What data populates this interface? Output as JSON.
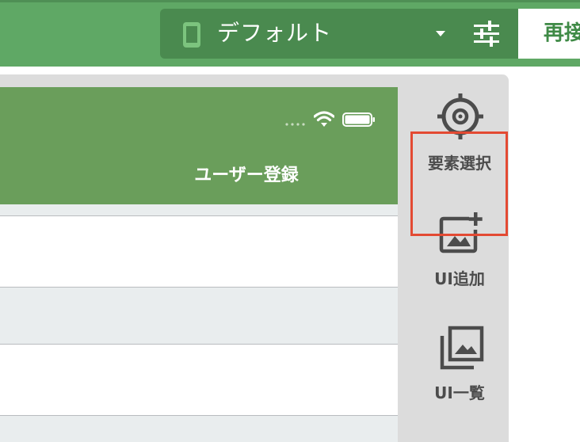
{
  "header": {
    "device_label": "デフォルト",
    "reload_label": "再接",
    "icons": {
      "device": "smartphone-icon",
      "caret": "caret-down-icon",
      "settings": "sliders-icon"
    }
  },
  "preview": {
    "title": "ユーザー登録",
    "status_icons": [
      "signal-dots-icon",
      "wifi-icon",
      "battery-icon"
    ]
  },
  "tools": [
    {
      "label": "要素選択",
      "icon": "crosshair-target-icon"
    },
    {
      "label": "UI追加",
      "icon": "add-image-icon",
      "selected": true
    },
    {
      "label": "UI一覧",
      "icon": "image-gallery-icon"
    }
  ],
  "colors": {
    "header_green": "#5fa865",
    "select_green": "#4a8a4f",
    "nav_green": "#6a9e5b",
    "highlight_red": "#e34a33",
    "sidebar_grey": "#dcdcdc"
  }
}
